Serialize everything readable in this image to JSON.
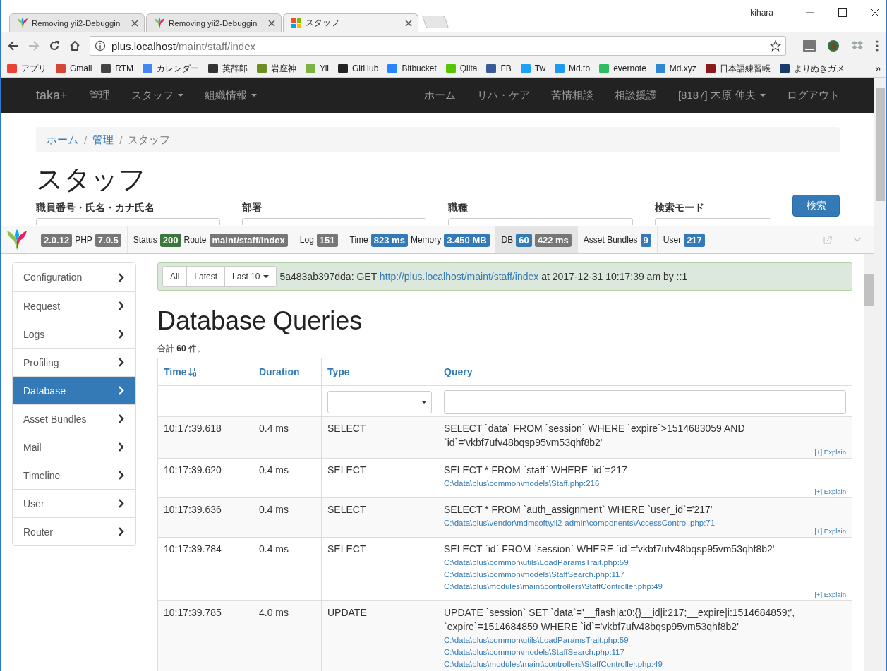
{
  "browser": {
    "tabs": [
      {
        "title": "Removing yii2-Debuggin",
        "kind": "leaf",
        "selected": false
      },
      {
        "title": "Removing yii2-Debuggin",
        "kind": "leaf",
        "selected": false
      },
      {
        "title": "スタッフ",
        "kind": "squares",
        "selected": true
      }
    ],
    "user": "kihara",
    "url": {
      "host": "plus.localhost",
      "path": "/maint/staff/index"
    },
    "bookmarks": [
      {
        "label": "アプリ",
        "color": "#ea4335"
      },
      {
        "label": "Gmail",
        "color": "#d44638"
      },
      {
        "label": "RTM",
        "color": "#444444"
      },
      {
        "label": "カレンダー",
        "color": "#4285f4"
      },
      {
        "label": "英辞郎",
        "color": "#333333"
      },
      {
        "label": "岩座神",
        "color": "#6b8e23"
      },
      {
        "label": "Yii",
        "color": "#7cb342"
      },
      {
        "label": "GitHub",
        "color": "#222222"
      },
      {
        "label": "Bitbucket",
        "color": "#2684ff"
      },
      {
        "label": "Qiita",
        "color": "#55c500"
      },
      {
        "label": "FB",
        "color": "#3b5998"
      },
      {
        "label": "Tw",
        "color": "#1da1f2"
      },
      {
        "label": "Md.to",
        "color": "#1d9bf0"
      },
      {
        "label": "evernote",
        "color": "#2dbe60"
      },
      {
        "label": "Md.xyz",
        "color": "#3088d4"
      },
      {
        "label": "日本語練習帳",
        "color": "#8b1a1a"
      },
      {
        "label": "よりぬきガメ",
        "color": "#1a3a6b"
      }
    ],
    "more": "»"
  },
  "site": {
    "brand": "taka+",
    "nav_left": [
      {
        "label": "管理",
        "dropdown": false
      },
      {
        "label": "スタッフ",
        "dropdown": true
      },
      {
        "label": "組織情報",
        "dropdown": true
      }
    ],
    "nav_right": [
      {
        "label": "ホーム",
        "dropdown": false
      },
      {
        "label": "リハ・ケア",
        "dropdown": false
      },
      {
        "label": "苦情相談",
        "dropdown": false
      },
      {
        "label": "相談援護",
        "dropdown": false
      },
      {
        "label": "[8187] 木原 伸夫",
        "dropdown": true
      },
      {
        "label": "ログアウト",
        "dropdown": false
      }
    ],
    "breadcrumb": {
      "separator": "/",
      "items": [
        {
          "label": "ホーム",
          "kind": "link"
        },
        {
          "label": "管理",
          "kind": "link"
        },
        {
          "label": "スタッフ",
          "kind": "current"
        }
      ]
    },
    "title": "スタッフ",
    "filters": [
      {
        "label": "職員番号・氏名・カナ氏名"
      },
      {
        "label": "部署"
      },
      {
        "label": "職種"
      },
      {
        "label": "検索モード"
      }
    ],
    "search_button": "検索"
  },
  "toolbar": {
    "panels": [
      {
        "selected": false,
        "parts": [
          {
            "kind": "badge",
            "text": "2.0.12",
            "color": "#777777"
          },
          {
            "kind": "label",
            "text": "PHP"
          },
          {
            "kind": "badge",
            "text": "7.0.5",
            "color": "#777777"
          }
        ]
      },
      {
        "selected": false,
        "parts": [
          {
            "kind": "label",
            "text": "Status"
          },
          {
            "kind": "badge",
            "text": "200",
            "color": "#3c763d"
          },
          {
            "kind": "label",
            "text": "Route"
          },
          {
            "kind": "badge",
            "text": "maint/staff/index",
            "color": "#777777"
          }
        ]
      },
      {
        "selected": false,
        "parts": [
          {
            "kind": "label",
            "text": "Log"
          },
          {
            "kind": "badge",
            "text": "151",
            "color": "#777777"
          }
        ]
      },
      {
        "selected": false,
        "parts": [
          {
            "kind": "label",
            "text": "Time"
          },
          {
            "kind": "badge",
            "text": "823 ms",
            "color": "#337ab7"
          },
          {
            "kind": "label",
            "text": "Memory"
          },
          {
            "kind": "badge",
            "text": "3.450 MB",
            "color": "#337ab7"
          }
        ]
      },
      {
        "selected": true,
        "parts": [
          {
            "kind": "label",
            "text": "DB"
          },
          {
            "kind": "badge",
            "text": "60",
            "color": "#337ab7"
          },
          {
            "kind": "badge",
            "text": "422 ms",
            "color": "#777777"
          }
        ]
      },
      {
        "selected": false,
        "parts": [
          {
            "kind": "label",
            "text": "Asset Bundles"
          },
          {
            "kind": "badge",
            "text": "9",
            "color": "#337ab7"
          }
        ]
      },
      {
        "selected": false,
        "parts": [
          {
            "kind": "label",
            "text": "User"
          },
          {
            "kind": "badge",
            "text": "217",
            "color": "#337ab7"
          }
        ]
      }
    ]
  },
  "debug": {
    "sidebar": [
      {
        "label": "Configuration",
        "selected": false
      },
      {
        "label": "Request",
        "selected": false
      },
      {
        "label": "Logs",
        "selected": false
      },
      {
        "label": "Profiling",
        "selected": false
      },
      {
        "label": "Database",
        "selected": true
      },
      {
        "label": "Asset Bundles",
        "selected": false
      },
      {
        "label": "Mail",
        "selected": false
      },
      {
        "label": "Timeline",
        "selected": false
      },
      {
        "label": "User",
        "selected": false
      },
      {
        "label": "Router",
        "selected": false
      }
    ],
    "summary": {
      "buttons": [
        {
          "label": "All",
          "dropdown": false
        },
        {
          "label": "Latest",
          "dropdown": false
        },
        {
          "label": "Last 10",
          "dropdown": true
        }
      ],
      "before": "5a483ab397dda: GET",
      "url": "http://plus.localhost/maint/staff/index",
      "after": "at 2017-12-31 10:17:39 am by ::1"
    },
    "heading": "Database Queries",
    "total": "合計 **60** 件。",
    "table": {
      "columns": [
        {
          "label": "Time",
          "sorted": true
        },
        {
          "label": "Duration",
          "sorted": false
        },
        {
          "label": "Type",
          "sorted": false
        },
        {
          "label": "Query",
          "sorted": false
        }
      ],
      "filters": [
        {
          "kind": "none"
        },
        {
          "kind": "none"
        },
        {
          "kind": "select"
        },
        {
          "kind": "input"
        }
      ],
      "rows": [
        {
          "time": "10:17:39.618",
          "duration": "0.4 ms",
          "type": "SELECT",
          "query": "SELECT `data` FROM `session` WHERE `expire`>1514683059 AND `id`='vkbf7ufv48bqsp95vm53qhf8b2'",
          "trace": [],
          "explain": "[+] Explain"
        },
        {
          "time": "10:17:39.620",
          "duration": "0.4 ms",
          "type": "SELECT",
          "query": "SELECT * FROM `staff` WHERE `id`=217",
          "trace": [
            "C:\\data\\plus\\common\\models\\Staff.php:216"
          ],
          "explain": "[+] Explain"
        },
        {
          "time": "10:17:39.636",
          "duration": "0.4 ms",
          "type": "SELECT",
          "query": "SELECT * FROM `auth_assignment` WHERE `user_id`='217'",
          "trace": [
            "C:\\data\\plus\\vendor\\mdmsoft\\yii2-admin\\components\\AccessControl.php:71"
          ],
          "explain": "[+] Explain"
        },
        {
          "time": "10:17:39.784",
          "duration": "0.4 ms",
          "type": "SELECT",
          "query": "SELECT `id` FROM `session` WHERE `id`='vkbf7ufv48bqsp95vm53qhf8b2'",
          "trace": [
            "C:\\data\\plus\\common\\utils\\LoadParamsTrait.php:59",
            "C:\\data\\plus\\common\\models\\StaffSearch.php:117",
            "C:\\data\\plus\\modules\\maint\\controllers\\StaffController.php:49"
          ],
          "explain": "[+] Explain"
        },
        {
          "time": "10:17:39.785",
          "duration": "4.0 ms",
          "type": "UPDATE",
          "query": "UPDATE `session` SET `data`='__flash|a:0:{}__id|i:217;__expire|i:1514684859;', `expire`=1514684859 WHERE `id`='vkbf7ufv48bqsp95vm53qhf8b2'",
          "trace": [
            "C:\\data\\plus\\common\\utils\\LoadParamsTrait.php:59",
            "C:\\data\\plus\\common\\models\\StaffSearch.php:117",
            "C:\\data\\plus\\modules\\maint\\controllers\\StaffController.php:49"
          ]
        }
      ]
    }
  }
}
